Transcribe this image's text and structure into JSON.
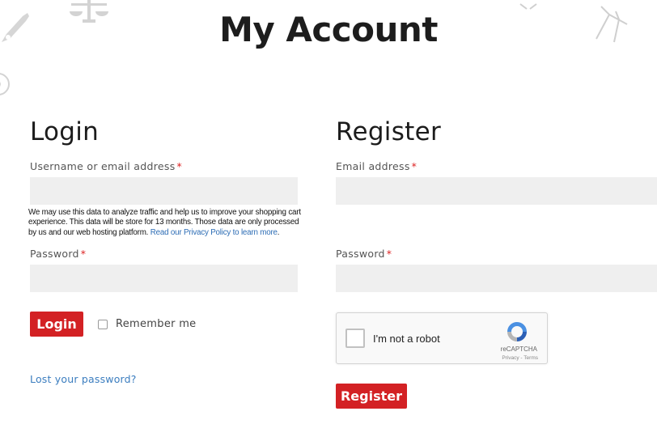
{
  "page": {
    "title": "My Account"
  },
  "login": {
    "heading": "Login",
    "username_label": "Username or email address",
    "username_value": "",
    "required_mark": "*",
    "privacy_text": "We may use this data to analyze traffic and help us to improve your shopping cart experience. This data will be store for 13 months. Those data are only processed by us and our  web hosting platform. ",
    "privacy_link": "Read our Privacy Policy to learn more",
    "privacy_end": ".",
    "password_label": "Password",
    "password_value": "",
    "button_label": "Login",
    "remember_label": "Remember me",
    "lost_password": "Lost your password?"
  },
  "register": {
    "heading": "Register",
    "email_label": "Email address",
    "email_value": "",
    "password_label": "Password",
    "password_value": "",
    "required_mark": "*",
    "captcha": {
      "label": "I'm not a robot",
      "brand": "reCAPTCHA",
      "privacy": "Privacy",
      "terms": "Terms"
    },
    "button_label": "Register"
  },
  "colors": {
    "accent": "#d32124",
    "link": "#3b7dbf",
    "input_bg": "#efefef"
  },
  "decorations": [
    "fountain-pen-icon",
    "scales-icon",
    "compass-icon",
    "drafting-compass-icon"
  ]
}
